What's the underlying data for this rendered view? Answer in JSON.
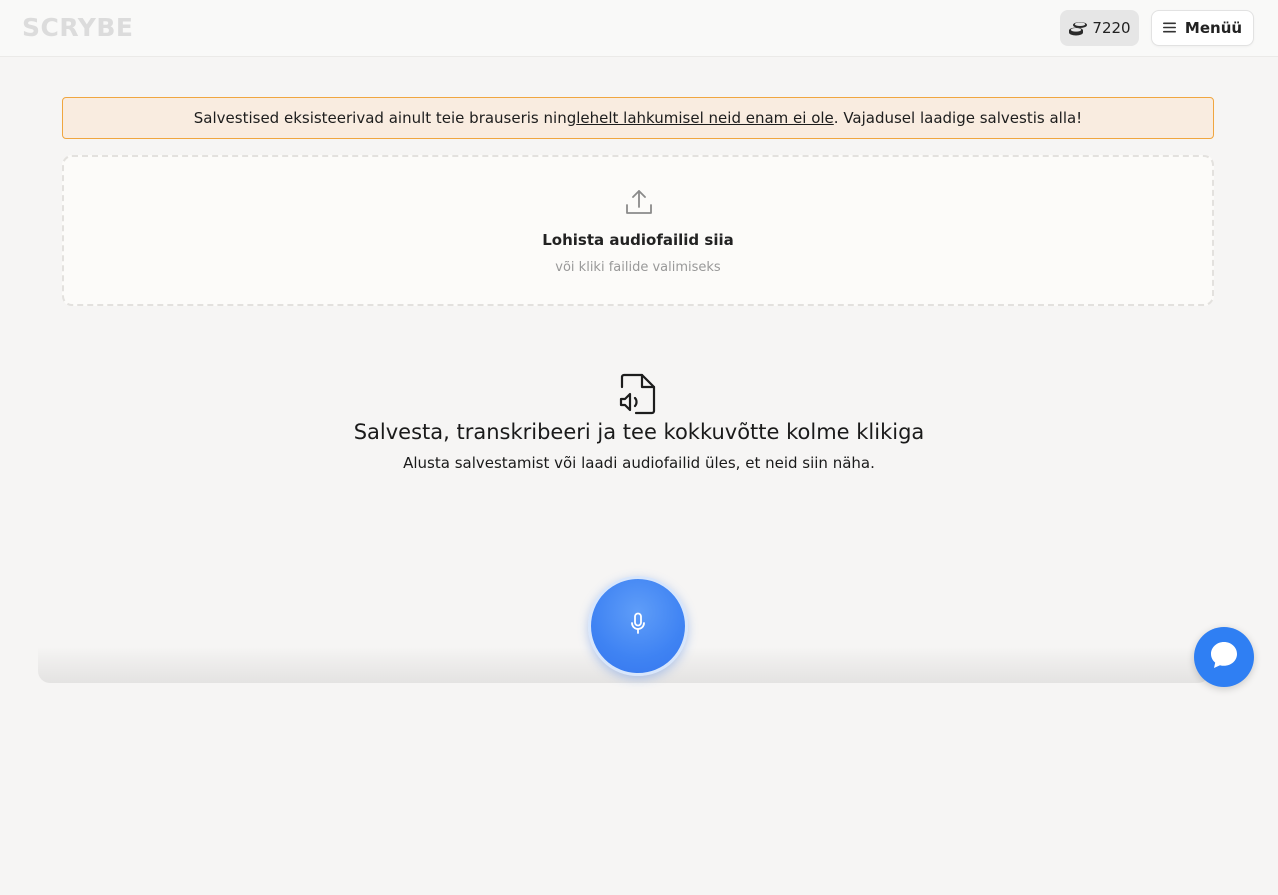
{
  "header": {
    "logo": "SCRYBE",
    "credits": "7220",
    "menu_label": "Menüü"
  },
  "warning": {
    "before": "Salvestised eksisteerivad ainult teie brauseris ning ",
    "link": "lehelt lahkumisel neid enam ei ole",
    "after": ". Vajadusel laadige salvestis alla!"
  },
  "dropzone": {
    "title": "Lohista audiofailid siia",
    "subtitle": "või kliki failide valimiseks"
  },
  "empty_state": {
    "title": "Salvesta, transkribeeri ja tee kokkuvõtte kolme klikiga",
    "subtitle": "Alusta salvestamist või laadi audiofailid üles, et neid siin näha."
  },
  "icons": {
    "credits": "coins-icon",
    "menu": "hamburger-icon",
    "upload": "upload-icon",
    "empty": "audio-file-icon",
    "record": "microphone-icon",
    "chat": "chat-icon"
  },
  "colors": {
    "accent": "#3f83f3",
    "warning_bg": "#f9ece0",
    "warning_border": "#f0a640",
    "chat": "#2f7ff3"
  }
}
